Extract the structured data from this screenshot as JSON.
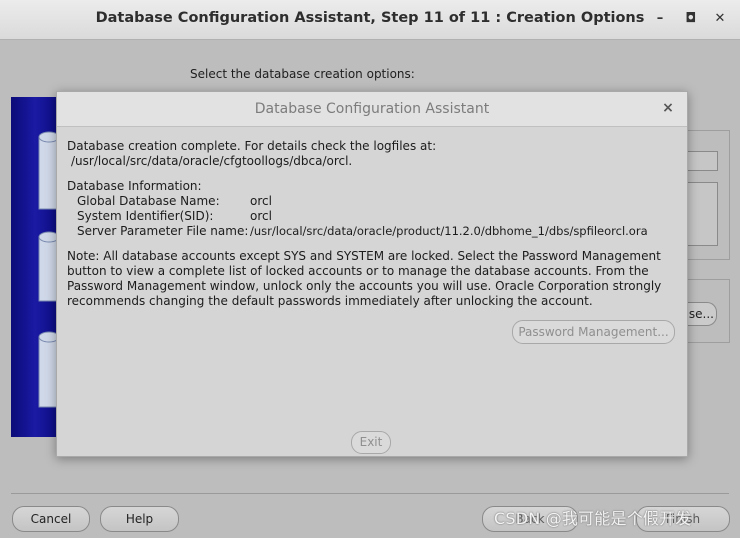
{
  "window": {
    "title": "Database Configuration Assistant, Step 11 of 11 : Creation Options",
    "minimize_glyph": "–",
    "maximize_glyph": "◘",
    "close_glyph": "✕"
  },
  "main": {
    "prompt": "Select the database creation options:",
    "browse_label": "se..."
  },
  "footer": {
    "cancel_label": "Cancel",
    "help_label": "Help",
    "back_label": "Back",
    "finish_label": "Finish"
  },
  "watermark": "CSDN @我可能是个假开发",
  "dialog": {
    "title": "Database Configuration Assistant",
    "close_glyph": "×",
    "complete_line1": "Database creation complete. For details check the logfiles at:",
    "complete_line2": "/usr/local/src/data/oracle/cfgtoollogs/dbca/orcl.",
    "info_heading": "Database Information:",
    "info_rows": [
      {
        "label": "Global Database Name:",
        "value": "orcl"
      },
      {
        "label": "System Identifier(SID):",
        "value": "orcl"
      },
      {
        "label": "Server Parameter File name:",
        "value": "/usr/local/src/data/oracle/product/11.2.0/dbhome_1/dbs/spfileorcl.ora"
      }
    ],
    "note_lines": [
      "Note: All database accounts except SYS and SYSTEM are locked. Select the Password Management",
      "button to view a complete list of locked accounts or to manage the database accounts. From the",
      "Password Management window, unlock only the accounts you will use. Oracle Corporation strongly",
      "recommends changing the default passwords immediately after unlocking the account."
    ],
    "password_button_label": "Password Management...",
    "exit_label": "Exit"
  },
  "colors": {
    "background": "#bdbdbd",
    "dialog_background": "#d5d5d5",
    "banner_blue": "#1a1aa4",
    "disabled_text": "#8f8f8f"
  }
}
